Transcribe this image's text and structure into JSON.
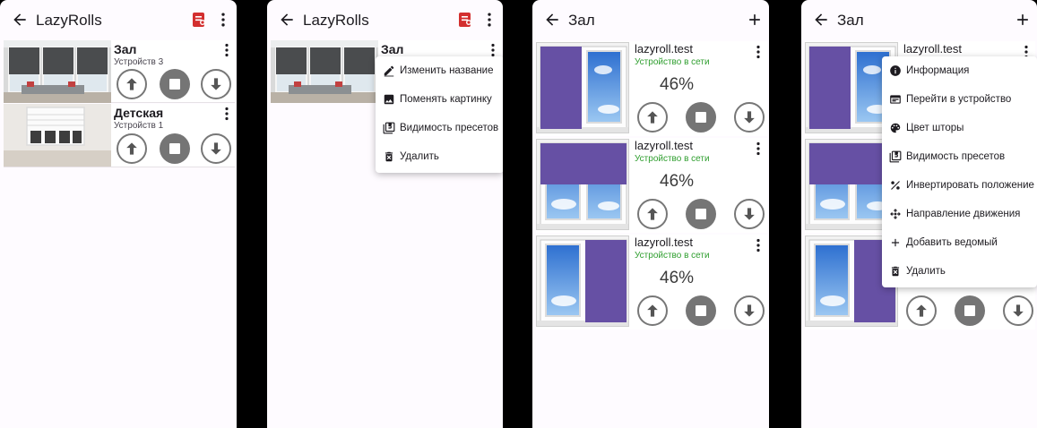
{
  "app": {
    "title": "LazyRolls"
  },
  "rooms": [
    {
      "name": "Зал",
      "subtitle": "Устройств 3"
    },
    {
      "name": "Детская",
      "subtitle": "Устройств 1"
    }
  ],
  "room_menu": {
    "room_name": "Зал",
    "items": [
      "Изменить название",
      "Поменять картинку",
      "Видимость пресетов",
      "Удалить"
    ]
  },
  "room_screen": {
    "title": "Зал"
  },
  "devices": [
    {
      "name": "lazyroll.test",
      "status": "Устройство в сети",
      "percent": "46%",
      "curtain": "left"
    },
    {
      "name": "lazyroll.test",
      "status": "Устройство в сети",
      "percent": "46%",
      "curtain": "top"
    },
    {
      "name": "lazyroll.test",
      "status": "Устройство в сети",
      "percent": "46%",
      "curtain": "right"
    }
  ],
  "device_menu": {
    "items": [
      "Информация",
      "Перейти в устройство",
      "Цвет шторы",
      "Видимость пресетов",
      "Инвертировать положение",
      "Направление движения",
      "Добавить ведомый",
      "Удалить"
    ]
  },
  "colors": {
    "curtain": "#6650a4",
    "status_online": "#2e9e2e",
    "doc_icon": "#d32f2f",
    "stop_button": "#757575"
  }
}
